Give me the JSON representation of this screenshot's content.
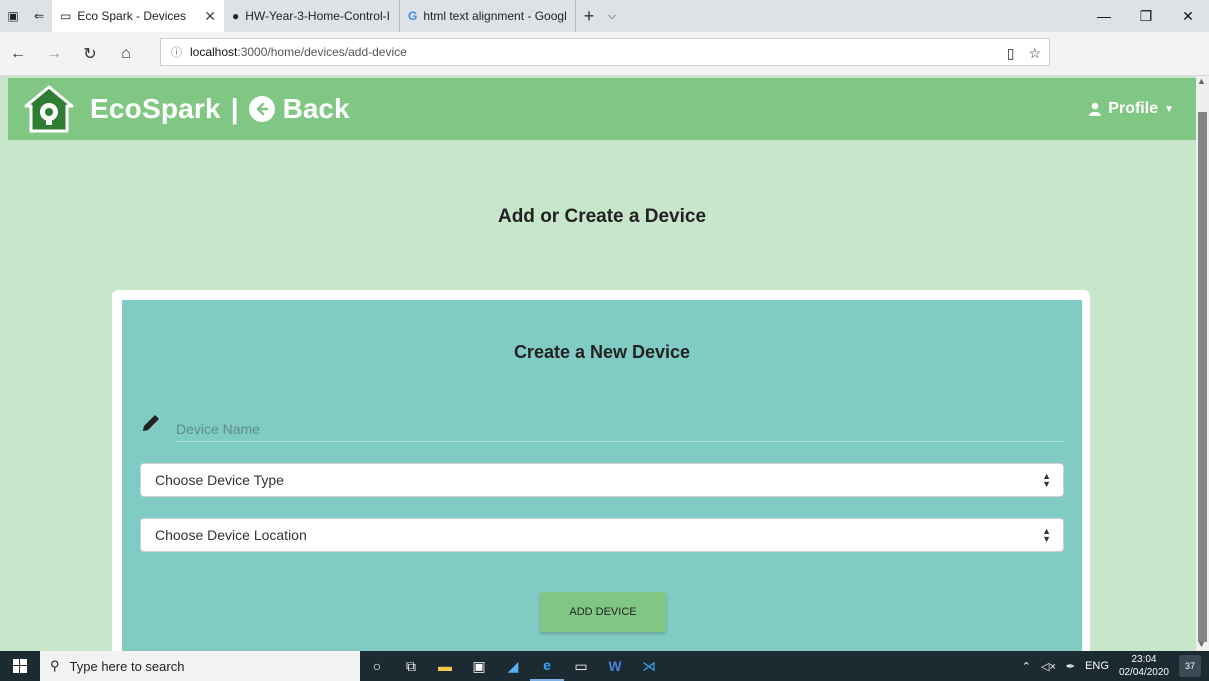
{
  "browser": {
    "tabs": [
      {
        "title": "Eco Spark - Devices",
        "active": true
      },
      {
        "title": "HW-Year-3-Home-Control-I",
        "active": false
      },
      {
        "title": "html text alignment - Googl",
        "active": false
      }
    ],
    "url_host": "localhost",
    "url_path": ":3000/home/devices/add-device"
  },
  "header": {
    "brand": "EcoSpark",
    "separator": "|",
    "back_label": "Back",
    "profile_label": "Profile"
  },
  "main": {
    "page_title": "Add or Create a Device",
    "card_title": "Create a New Device",
    "device_name_placeholder": "Device Name",
    "device_type_placeholder": "Choose Device Type",
    "device_location_placeholder": "Choose Device Location",
    "add_button_label": "ADD DEVICE"
  },
  "taskbar": {
    "search_placeholder": "Type here to search",
    "language": "ENG",
    "time": "23:04",
    "date": "02/04/2020",
    "notification_count": "37"
  },
  "colors": {
    "header_green": "#81c784",
    "page_bg": "#c8e6c9",
    "card_teal": "#80cbc4"
  }
}
